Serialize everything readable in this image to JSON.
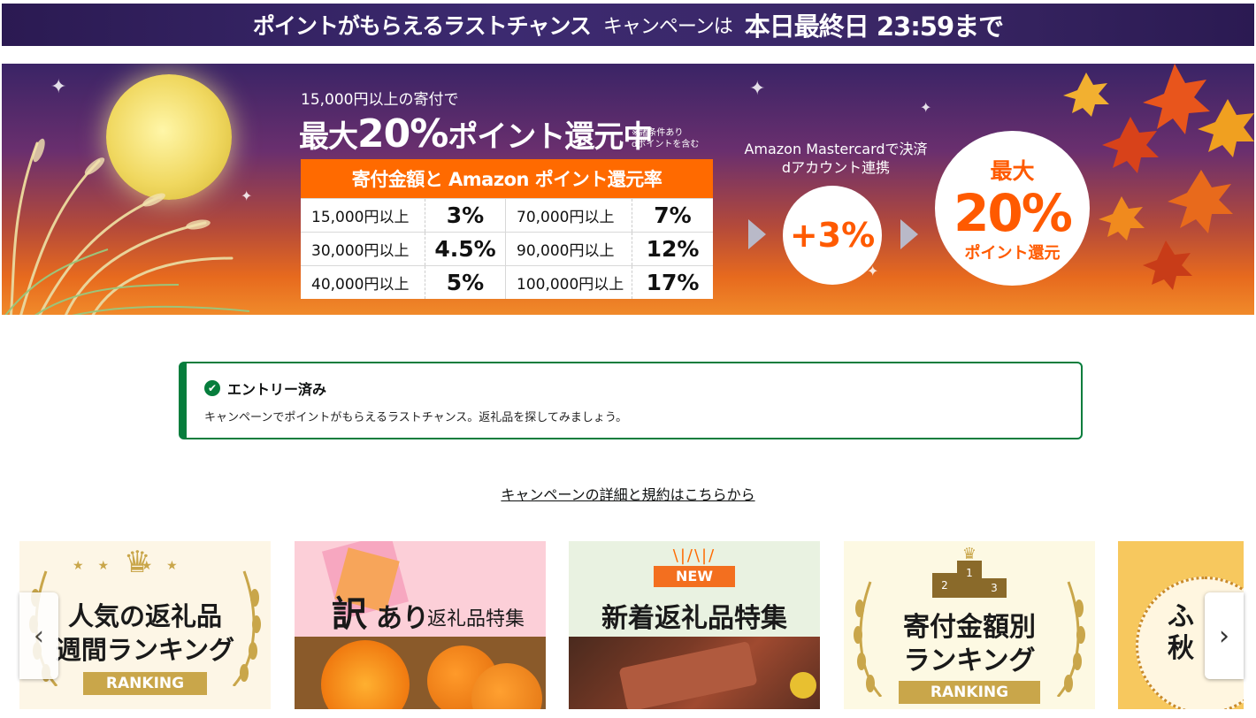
{
  "top_banner": {
    "lead": "ポイントがもらえるラストチャンス",
    "middle": "キャンペーンは",
    "deadline": "本日最終日 23:59まで"
  },
  "hero": {
    "condition": "15,000円以上の寄付で",
    "headline_pre": "最大",
    "headline_pct": "20%",
    "headline_post": "ポイント還元中",
    "note_1": "※諸条件あり",
    "note_2": "dポイントを含む",
    "table_title": "寄付金額と Amazon ポイント還元率",
    "rows": [
      {
        "amount_a": "15,000円以上",
        "rate_a": "3%",
        "amount_b": "70,000円以上",
        "rate_b": "7%"
      },
      {
        "amount_a": "30,000円以上",
        "rate_a": "4.5%",
        "amount_b": "90,000円以上",
        "rate_b": "12%"
      },
      {
        "amount_a": "40,000円以上",
        "rate_a": "5%",
        "amount_b": "100,000円以上",
        "rate_b": "17%"
      }
    ],
    "mastercard_line1": "Amazon Mastercardで決済",
    "mastercard_line2": "dアカウント連携",
    "plus_bonus": "+3%",
    "max_label": "最大",
    "max_pct": "20%",
    "max_sub": "ポイント還元",
    "colors": {
      "accent": "#ff6a00",
      "text_accent": "#ff5a00"
    }
  },
  "entry_notice": {
    "title": "エントリー済み",
    "message": "キャンペーンでポイントがもらえるラストチャンス。返礼品を探してみましょう。",
    "icon": "check-circle-icon",
    "color": "#067d3c"
  },
  "details_link": "キャンペーンの詳細と規約はこちらから",
  "carousel": {
    "cards": [
      {
        "line1": "人気の返礼品",
        "line2": "週間ランキング",
        "ribbon": "RANKING"
      },
      {
        "big": "訳",
        "mid": "あり",
        "small": "返礼品特集"
      },
      {
        "badge": "NEW",
        "title": "新着返礼品特集"
      },
      {
        "line1": "寄付金額別",
        "line2": "ランキング",
        "ribbon": "RANKING",
        "podium": [
          "2",
          "1",
          "3"
        ]
      },
      {
        "line1": "ふ",
        "line2": "秋"
      }
    ],
    "prev_icon": "‹",
    "next_icon": "›"
  }
}
